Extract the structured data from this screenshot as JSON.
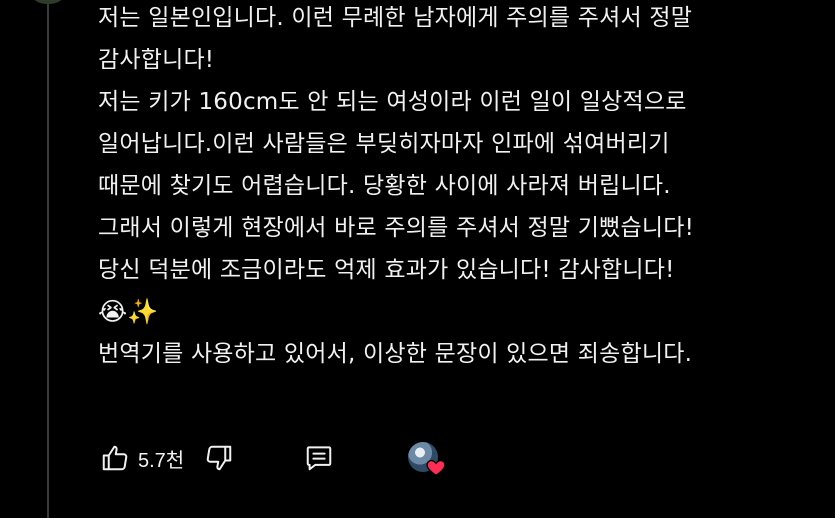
{
  "comment": {
    "lines": [
      "저는 일본인입니다. 이런 무례한 남자에게 주의를 주셔서 정말",
      "감사합니다!",
      "저는 키가 160cm도 안 되는 여성이라 이런 일이 일상적으로",
      "일어납니다.이런 사람들은 부딪히자마자 인파에 섞여버리기",
      "때문에 찾기도 어렵습니다. 당황한 사이에 사라져 버립니다.",
      "그래서 이렇게 현장에서 바로 주의를 주셔서 정말 기뻤습니다!",
      "당신 덕분에 조금이라도 억제 효과가 있습니다! 감사합니다!",
      "😭✨",
      "번역기를 사용하고 있어서, 이상한 문장이 있으면 죄송합니다."
    ]
  },
  "actions": {
    "like_icon": "thumbs-up-icon",
    "like_count": "5.7천",
    "dislike_icon": "thumbs-down-icon",
    "reply_icon": "comment-icon",
    "creator_heart_icon": "heart-icon"
  },
  "colors": {
    "background": "#000000",
    "text": "#f1f1f1",
    "thread_line": "#3a3a3a",
    "heart": "#ff2d55"
  }
}
